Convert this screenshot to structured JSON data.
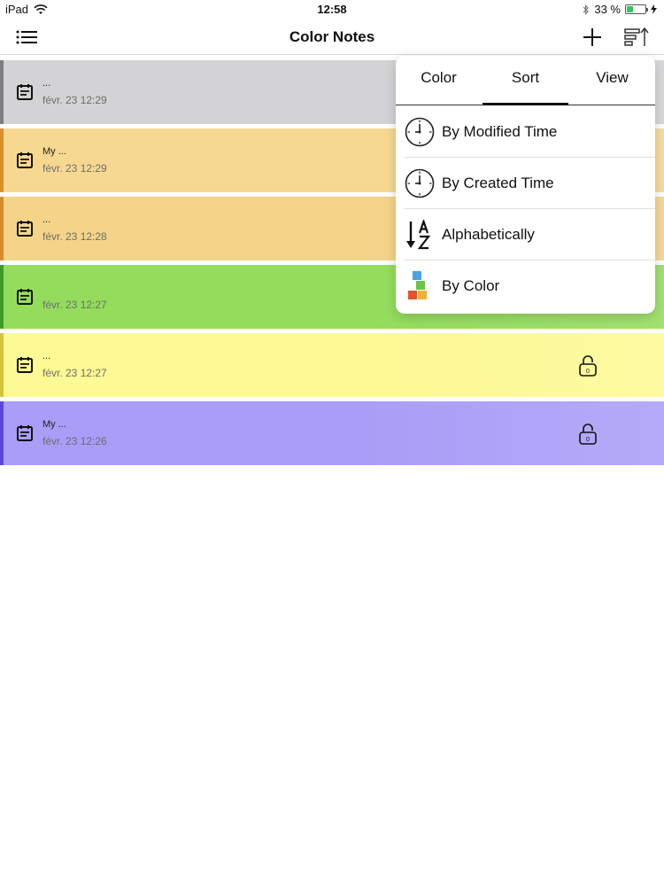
{
  "status_bar": {
    "device": "iPad",
    "time": "12:58",
    "battery": "33 %",
    "battery_level": 0.33
  },
  "navbar": {
    "title": "Color Notes"
  },
  "popover": {
    "tabs": [
      {
        "label": "Color"
      },
      {
        "label": "Sort",
        "active": true
      },
      {
        "label": "View"
      }
    ],
    "sort_options": [
      {
        "label": "By Modified Time"
      },
      {
        "label": "By Created Time"
      },
      {
        "label": "Alphabetically"
      },
      {
        "label": "By Color"
      }
    ]
  },
  "notes": [
    {
      "title": "...",
      "date": "févr. 23  12:29",
      "color": "#d3d2d4",
      "bar": "#7d7d7d",
      "locked": false
    },
    {
      "title": "My ...",
      "date": "févr. 23  12:29",
      "color": "#f7d891",
      "bar": "#d8902c",
      "locked": false
    },
    {
      "title": "...",
      "date": "févr. 23  12:28",
      "color": "#f4d489",
      "bar": "#d98a2c",
      "locked": false
    },
    {
      "title": "",
      "date": "févr. 23  12:27",
      "color": "#94dd5c",
      "bar": "#3d9a25",
      "locked": false
    },
    {
      "title": "...",
      "date": "févr. 23  12:27",
      "color": "#fdf994",
      "bar": "#d6c33c",
      "locked": true,
      "lock_label": "0"
    },
    {
      "title": "My ...",
      "date": "févr. 23  12:26",
      "color": "#a99df7",
      "bar": "#5a45d8",
      "locked": true,
      "lock_label": "0"
    }
  ]
}
